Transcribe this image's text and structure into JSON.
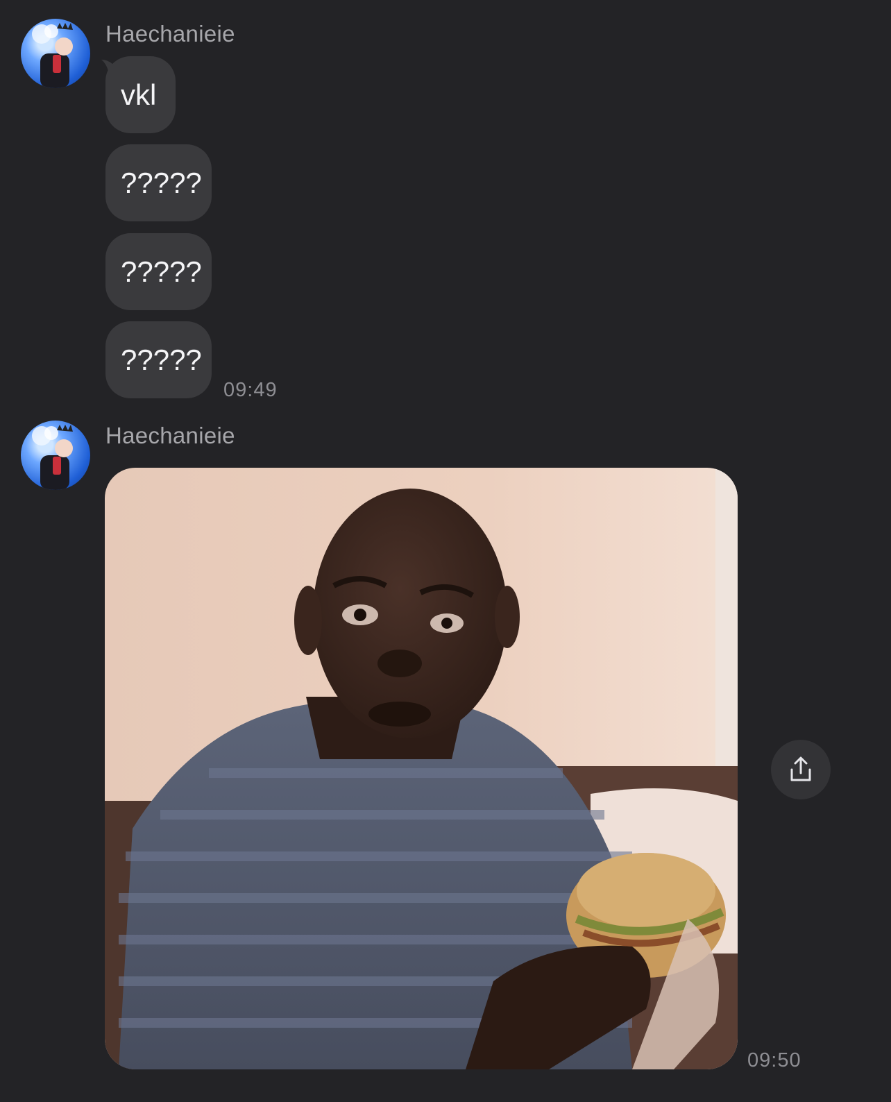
{
  "messages": [
    {
      "sender": "Haechanieie",
      "avatar_icon": "profile-avatar",
      "bubbles": [
        "vkl",
        "?????",
        "?????",
        "?????"
      ],
      "time": "09:49"
    },
    {
      "sender": "Haechanieie",
      "avatar_icon": "profile-avatar",
      "attachment": "photo",
      "time": "09:50",
      "share_icon": "share-icon"
    }
  ],
  "colors": {
    "background": "#232326",
    "bubble": "#3a3a3d",
    "sender_text": "#a7a7ab",
    "timestamp": "#8e8e93"
  }
}
